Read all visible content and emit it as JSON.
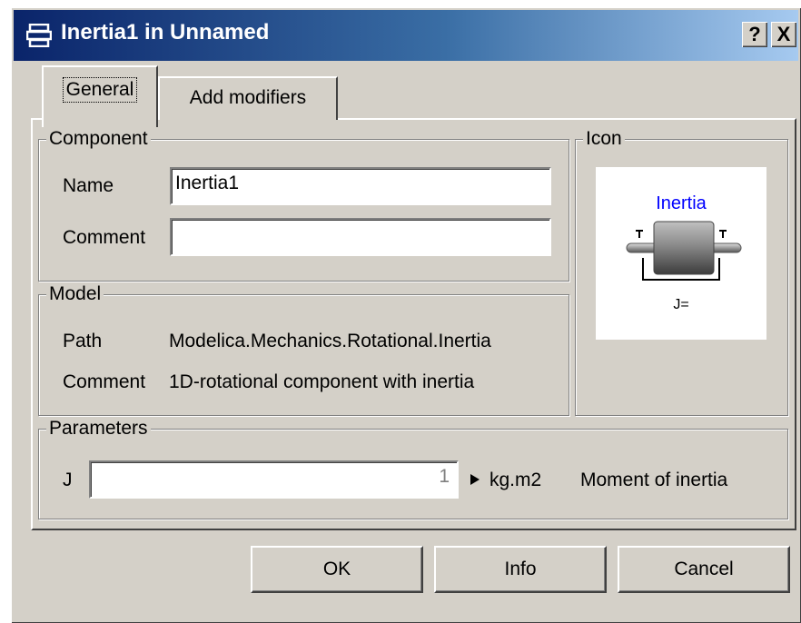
{
  "window": {
    "title": "Inertia1 in Unnamed",
    "help_button": "?",
    "close_button": "X"
  },
  "tabs": [
    {
      "label": "General",
      "selected": true
    },
    {
      "label": "Add modifiers",
      "selected": false
    }
  ],
  "component": {
    "legend": "Component",
    "name_label": "Name",
    "name_value": "Inertia1",
    "comment_label": "Comment",
    "comment_value": ""
  },
  "icon_group": {
    "legend": "Icon",
    "caption": "Inertia",
    "param_label": "J=",
    "caption_color": "#0000ff"
  },
  "model": {
    "legend": "Model",
    "path_label": "Path",
    "path_value": "Modelica.Mechanics.Rotational.Inertia",
    "comment_label": "Comment",
    "comment_value": "1D-rotational component with inertia"
  },
  "parameters": {
    "legend": "Parameters",
    "rows": [
      {
        "name": "J",
        "value": "1",
        "unit": "kg.m2",
        "description": "Moment of inertia"
      }
    ]
  },
  "buttons": {
    "ok": "OK",
    "info": "Info",
    "cancel": "Cancel"
  },
  "icons": {
    "title": "window-icon",
    "parameter_menu": "triangle-right-icon"
  },
  "colors": {
    "title_gradient_start": "#0a246a",
    "title_gradient_end": "#a6caf0",
    "dialog_face": "#d4d0c8"
  }
}
